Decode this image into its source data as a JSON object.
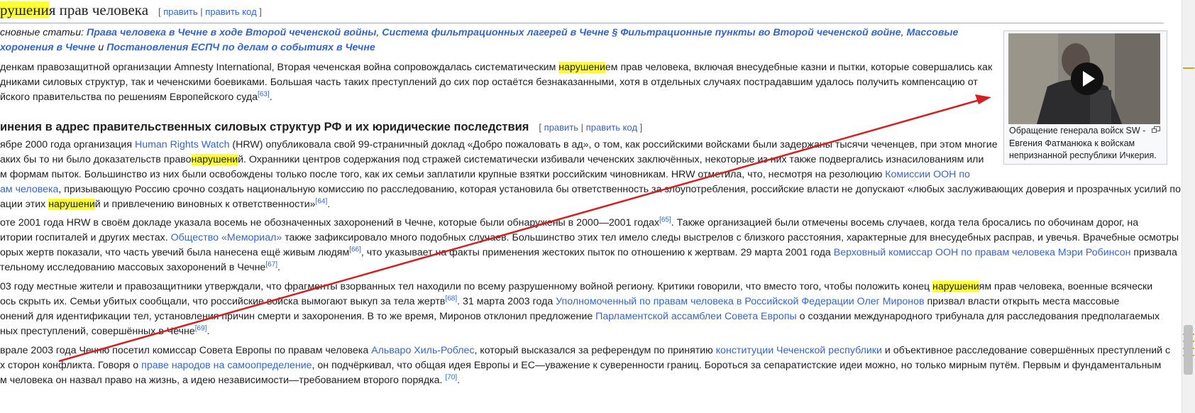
{
  "section": {
    "title_highlight": "рушени",
    "title_rest": "я прав человека",
    "edit_label": "править",
    "edit_code_label": "править код"
  },
  "hatnote": {
    "prefix": "сновные статьи: ",
    "link1": "Права человека в Чечне в ходе Второй чеченской войны",
    "link2": "Система фильтрационных лагерей в Чечне § Фильтрационные пункты во Второй чеченской войне",
    "link3a": "Массовые",
    "link3b": "хоронения в Чечне",
    "and": " и ",
    "link4": "Постановления ЕСПЧ по делам о событиях в Чечне"
  },
  "paragraphs": {
    "p1": {
      "l1a": "денкам правозащитной организации Amnesty International, Вторая чеченская война сопровождалась систематическим ",
      "l1h": "нарушени",
      "l1b": "ем прав человека, включая внесудебные казни и пытки, которые совершались как",
      "l2": "дниками силовых структур, так и чеченскими боевиками. Большая часть таких преступлений до сих пор остаётся безнаказанными, хотя в отдельных случаях пострадавшим удалось получить компенсацию от",
      "l3": "йского правительства по решениям Европейского суда",
      "l3ref": "[63]",
      "l3end": "."
    },
    "h3": "инения в адрес правительственных силовых структур РФ и их юридические последствия",
    "p2": {
      "l1a": "ябре 2000 года организация ",
      "l1link": "Human Rights Watch",
      "l1b": " (HRW) опубликовала свой 99-страничный доклад «Добро пожаловать в ад», о том, как российскими войсками были задержаны тысячи чеченцев, при этом многие",
      "l2a": "аких бы то ни было доказательств право",
      "l2h": "нарушени",
      "l2b": "й. Охранники центров содержания под стражей систематически избивали чеченских заключённых, некоторые из них также подвергались изнасилованиям или",
      "l3a": "м формам пыток. Большинство из них были освобождены только после того, как их семьи заплатили крупные взятки российским чиновникам. HRW отметила, что, несмотря на резолюцию ",
      "l3link": "Комиссии ООН по",
      "l4link": "ам человека",
      "l4b": ", призывающую Россию срочно создать национальную комиссию по расследованию, которая установила бы ответственность за злоупотребления, российские власти не допускают «любых заслуживающих доверия и прозрачных усилий по",
      "l5a": "ации этих ",
      "l5h": "нарушени",
      "l5b": "й и привлечению виновных к ответственности»",
      "l5ref": "[64]",
      "l5end": "."
    },
    "p3": {
      "l1a": "оте 2001 года HRW в своём докладе указала восемь не обозначенных захоронений в Чечне, которые были обнаружены в 2000—2001 годах",
      "l1ref": "[65]",
      "l1b": ". Также организацией были отмечены восемь случаев, когда тела бросались по обочинам дорог, на",
      "l2a": "итории госпиталей и других местах. ",
      "l2link": "Общество «Мемориал»",
      "l2b": " также зафиксировало много подобных случаев. Большинство этих тел имело следы выстрелов с близкого расстояния, характерные для внесудебных расправ, и увечья. Врачебные осмотры",
      "l3a": "орых жертв показали, что часть увечий была нанесена ещё живым людям",
      "l3ref": "[66]",
      "l3b": ", что указывает на факты применения жестоких пыток по отношению к жертвам. 29 марта 2001 года ",
      "l3link": "Верховный комиссар ООН по правам человека Мэри Робинсон",
      "l3c": " призвала",
      "l4a": "тельному исследованию массовых захоронений в Чечне",
      "l4ref": "[67]",
      "l4end": "."
    },
    "p4": {
      "l1a": "03 году местные жители и правозащитники утверждали, что фрагменты взорванных тел находили по всему разрушенному войной региону. Критики говорили, что вместо того, чтобы положить конец ",
      "l1h": "нарушени",
      "l1b": "ям прав человека, военные всячески",
      "l2a": "ось скрыть их. Семьи убитых сообщали, что российские войска вымогают выкуп за тела жертв",
      "l2ref": "[68]",
      "l2b": ". 31 марта 2003 года ",
      "l2link": "Уполномоченный по правам человека в Российской Федерации Олег Миронов",
      "l2c": " призвал власти открыть места массовые",
      "l3a": "онений для идентификации тел, установления причин смерти и захоронения. В то же время, Миронов отклонил предложение ",
      "l3link": "Парламентской ассамблеи Совета Европы",
      "l3b": " о создании международного трибунала для расследования предполагаемых",
      "l4a": "ных преступлений, совершённых в Чечне",
      "l4ref": "[69]",
      "l4end": "."
    },
    "p5": {
      "l1a": "врале 2003 года Чечню посетил комиссар Совета Европы по правам человека ",
      "l1link": "Альваро Хиль-Роблес",
      "l1b": ", который высказался за референдум по принятию ",
      "l1link2": "конституции Чеченской республики",
      "l1c": " и объективное расследование совершённых преступлений с",
      "l2a": "х сторон конфликта. Говоря о ",
      "l2link": "праве народов на самоопределение",
      "l2b": ", он подчёркивал, что общая идея Европы и ЕС—уважение к суверенности границ. Бороться за сепаратистские идеи можно, но только мирным путём. Первым и фундаментальным",
      "l3a": "м человека он назвал право на жизнь, а идею независимости—требованием второго порядка. ",
      "l3ref": "[70]",
      "l3end": "."
    }
  },
  "thumbnail": {
    "caption": "Обращение генерала войск SW - Евгения Фатманюка к войскам непризнанной республики Ичкерия.",
    "icon": "play-icon"
  },
  "colors": {
    "link": "#3366cc",
    "highlight": "#ffff33",
    "arrow": "#d42020"
  }
}
